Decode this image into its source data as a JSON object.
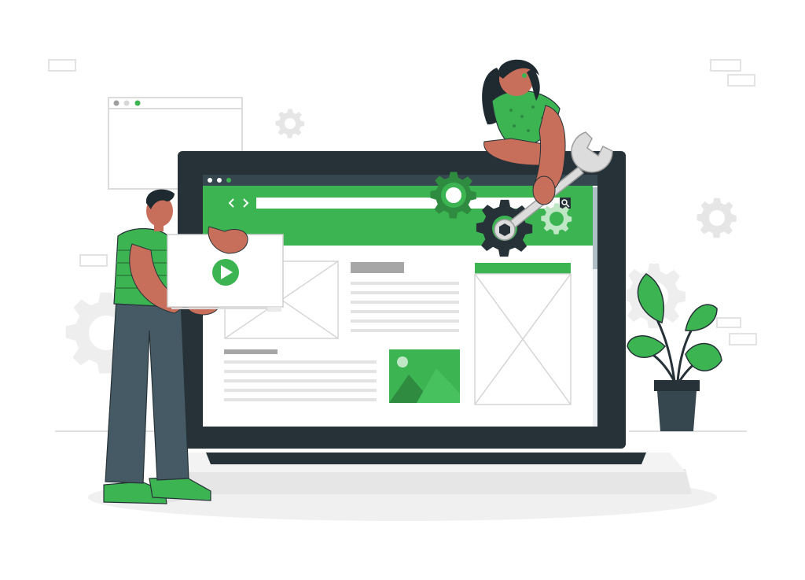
{
  "palette": {
    "accent": "#3cb452",
    "accent_dark": "#2e8b3f",
    "accent_light": "#bfe7c6",
    "bezel": "#263238",
    "bezel_mid": "#37474f",
    "skin": "#c86f5b",
    "skin_dark": "#a95a47",
    "hair": "#1e2a30",
    "pants": "#455a64",
    "outline_grey": "#d9d9d9",
    "block_grey": "#a6a6a6",
    "line_grey": "#e0e0e0",
    "floor": "#f0f0f0"
  },
  "browser_window": {
    "window_dots": [
      "dot-close",
      "dot-minimize",
      "dot-maximize"
    ],
    "nav_back_icon": "chevron-left-icon",
    "nav_forward_icon": "chevron-right-icon",
    "search_icon": "magnifier-icon"
  },
  "video_card": {
    "play_icon": "play-icon"
  },
  "figures": {
    "man": "man-holding-video-card",
    "woman": "woman-holding-wrench"
  },
  "decorations": [
    "gear-icon",
    "wrench-icon",
    "potted-plant",
    "window-outline-sketch"
  ]
}
